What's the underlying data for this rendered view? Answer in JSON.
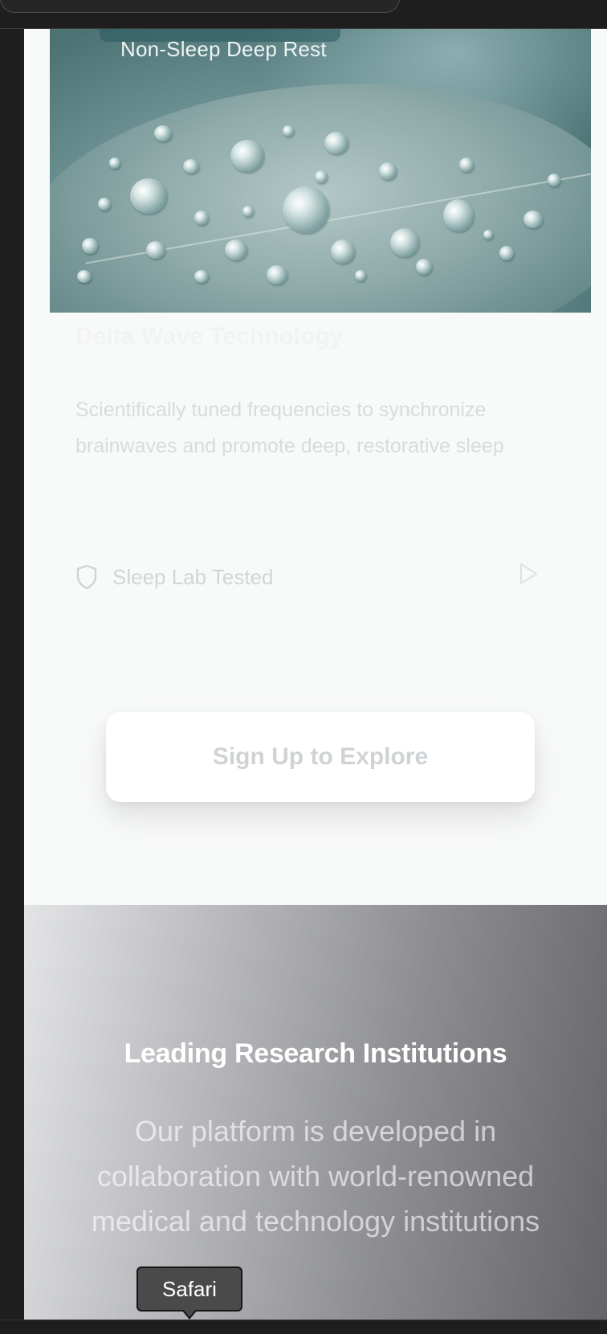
{
  "card": {
    "image_label": "Non-Sleep Deep Rest",
    "title": "Delta Wave Technology",
    "description": "Scientifically tuned frequencies to synchronize brainwaves and promote deep, restorative sleep",
    "badge": "Sleep Lab Tested",
    "badge_icon": "shield-icon",
    "action_icon": "play-icon"
  },
  "cta": {
    "label": "Sign Up to Explore"
  },
  "research": {
    "title": "Leading Research Institutions",
    "body": "Our platform is developed in collaboration with world-renowned medical and technology institutions"
  },
  "tooltip": {
    "label": "Safari"
  }
}
